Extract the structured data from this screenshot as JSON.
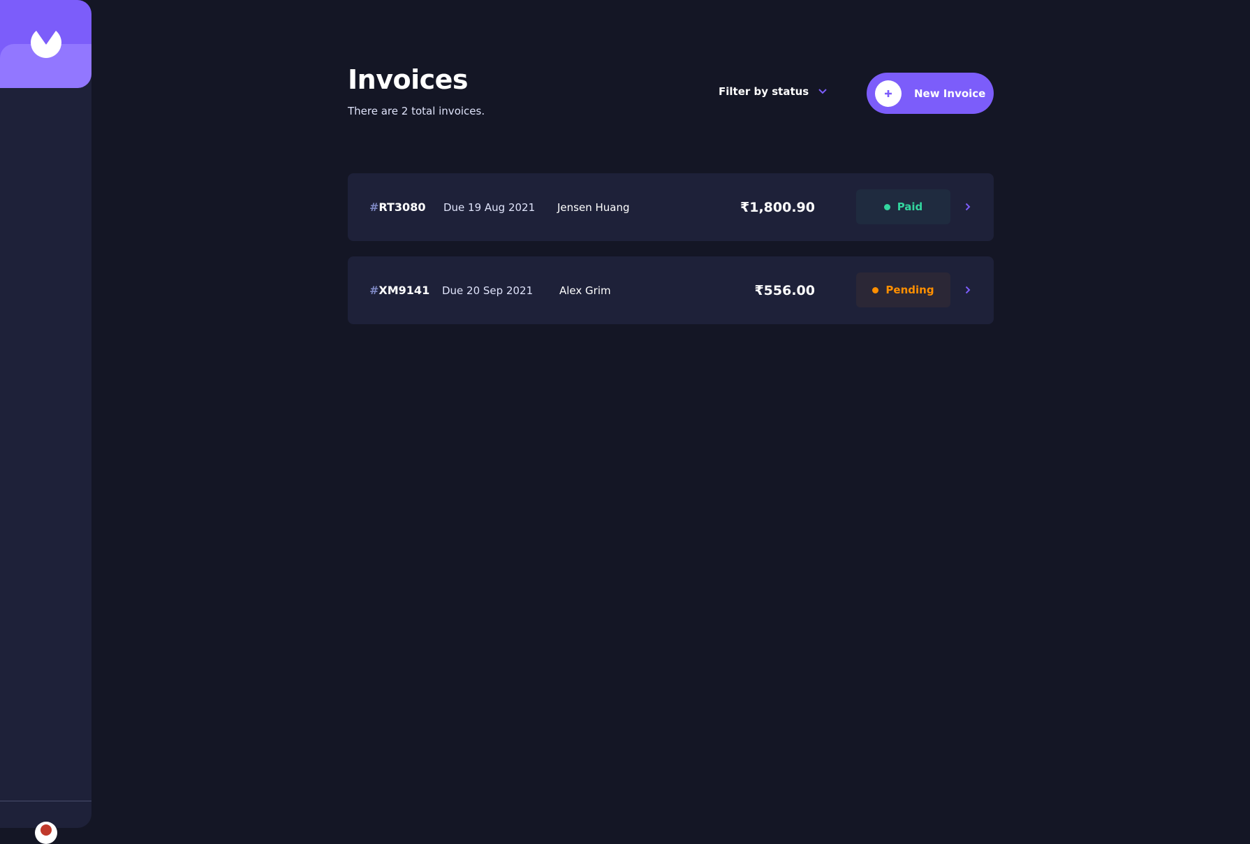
{
  "header": {
    "title": "Invoices",
    "subtitle": "There are 2 total invoices.",
    "filter_label": "Filter by status",
    "new_invoice_label": "New Invoice"
  },
  "invoices": [
    {
      "hash": "#",
      "id": "RT3080",
      "due": "Due 19 Aug 2021",
      "client": "Jensen Huang",
      "amount": "₹1,800.90",
      "status": "Paid",
      "status_color": "#33D69F",
      "status_bg": "#1F2B3F"
    },
    {
      "hash": "#",
      "id": "XM9141",
      "due": "Due 20 Sep 2021",
      "client": "Alex Grim",
      "amount": "₹556.00",
      "status": "Pending",
      "status_color": "#FF8F00",
      "status_bg": "#2B2736"
    }
  ],
  "colors": {
    "background": "#141625",
    "sidebar": "#1E2139",
    "accent": "#7C5DFA",
    "accent_light": "#9277FF",
    "card": "#1E2139"
  }
}
